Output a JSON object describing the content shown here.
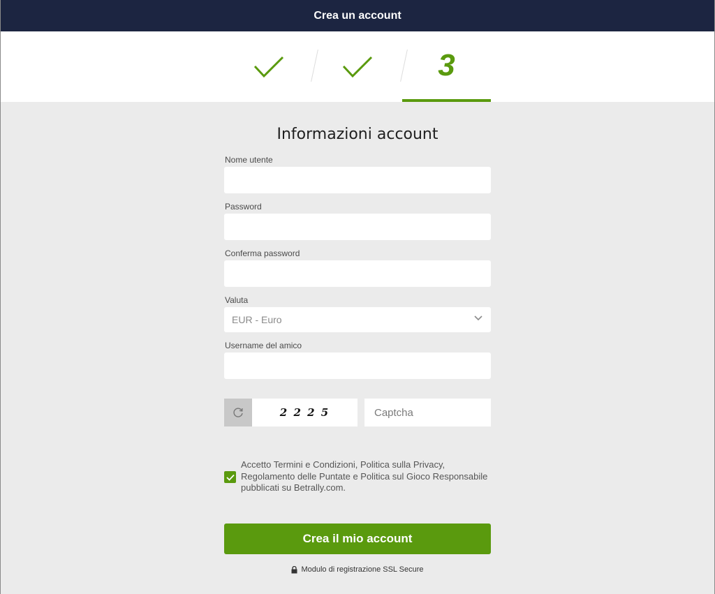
{
  "header": {
    "title": "Crea un account"
  },
  "steps": {
    "current_step": "3"
  },
  "form": {
    "title": "Informazioni account",
    "username_label": "Nome utente",
    "password_label": "Password",
    "confirm_password_label": "Conferma password",
    "currency_label": "Valuta",
    "currency_selected": "EUR - Euro",
    "friend_label": "Username del amico",
    "captcha_code": "2 2 2 5",
    "captcha_placeholder": "Captcha",
    "terms_text": "Accetto Termini e Condizioni, Politica sulla Privacy, Regolamento delle Puntate e Politica sul Gioco Responsabile pubblicati su Betrally.com.",
    "terms_checked": true,
    "submit_label": "Crea il mio account",
    "secure_note": "Modulo di registrazione SSL Secure"
  },
  "colors": {
    "header_bg": "#1c2541",
    "accent_green": "#5a9a0e",
    "page_bg": "#ebebeb"
  },
  "icons": {
    "step_done": "checkmark-icon",
    "currency_dropdown": "chevron-down-icon",
    "captcha_refresh": "refresh-icon",
    "terms_checkbox": "checkbox-checked-icon",
    "secure": "lock-icon"
  }
}
